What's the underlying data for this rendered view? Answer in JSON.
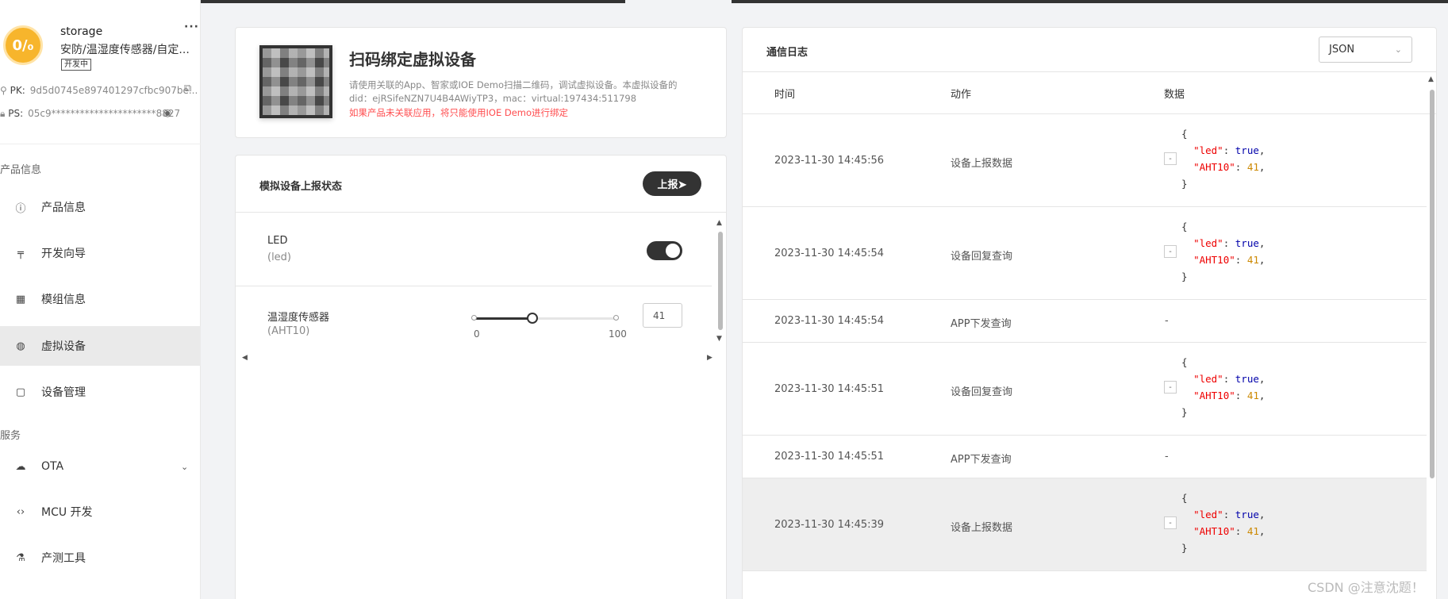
{
  "product": {
    "logo_text": "0/₀",
    "name": "storage",
    "category": "安防/温湿度传感器/自定...",
    "status_badge": "开发中",
    "more": "···",
    "pk_label": "PK:",
    "pk_value": "9d5d0745e897401297cfbc907be...",
    "ps_label": "PS:",
    "ps_value": "05c9**********************8827"
  },
  "sidebar": {
    "section_product": "产品信息",
    "section_service": "服务",
    "items": [
      {
        "label": "产品信息",
        "icon": "info-icon"
      },
      {
        "label": "开发向导",
        "icon": "signpost-icon"
      },
      {
        "label": "模组信息",
        "icon": "grid-icon"
      },
      {
        "label": "虚拟设备",
        "icon": "virtual-device-icon"
      },
      {
        "label": "设备管理",
        "icon": "clipboard-icon"
      },
      {
        "label": "OTA",
        "icon": "cloud-upload-icon"
      },
      {
        "label": "MCU 开发",
        "icon": "code-icon"
      },
      {
        "label": "产测工具",
        "icon": "test-tube-icon"
      }
    ]
  },
  "qr": {
    "title": "扫码绑定虚拟设备",
    "desc_line1": "请使用关联的App、智家或IOE Demo扫描二维码，调试虚拟设备。本虚拟设备的",
    "desc_line2": "did：ejRSifeNZN7U4B4AWiyTP3，mac：virtual:197434:511798",
    "warning": "如果产品未关联应用，将只能使用IOE Demo进行绑定"
  },
  "simulate": {
    "title": "模拟设备上报状态",
    "report_button": "上报➤",
    "props": [
      {
        "name": "LED",
        "id": "(led)",
        "value": true
      },
      {
        "name": "温湿度传感器",
        "id": "(AHT10)",
        "value": "41",
        "min": "0",
        "max": "100",
        "percent": 41
      }
    ]
  },
  "log": {
    "title": "通信日志",
    "format": "JSON",
    "columns": {
      "time": "时间",
      "action": "动作",
      "data": "数据"
    },
    "rows": [
      {
        "time": "2023-11-30 14:45:56",
        "action": "设备上报数据",
        "has_json": true
      },
      {
        "time": "2023-11-30 14:45:54",
        "action": "设备回复查询",
        "has_json": true
      },
      {
        "time": "2023-11-30 14:45:54",
        "action": "APP下发查询",
        "has_json": false,
        "data": "-"
      },
      {
        "time": "2023-11-30 14:45:51",
        "action": "设备回复查询",
        "has_json": true
      },
      {
        "time": "2023-11-30 14:45:51",
        "action": "APP下发查询",
        "has_json": false,
        "data": "-"
      },
      {
        "time": "2023-11-30 14:45:39",
        "action": "设备上报数据",
        "has_json": true
      }
    ],
    "json_payload": {
      "led": "true",
      "AHT10": "41"
    },
    "json_collapse": "-"
  },
  "watermark": "CSDN @注意沈题！"
}
